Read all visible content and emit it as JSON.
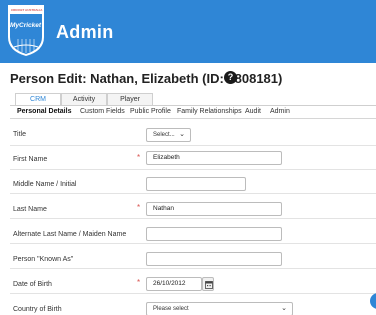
{
  "header": {
    "title": "Admin",
    "logo_text": "MyCricket",
    "logo_sub": "CRICKET AUSTRALIA"
  },
  "page": {
    "title": "Person Edit: Nathan, Elizabeth (ID: 1808181)",
    "help_icon": "question-circle-icon"
  },
  "top_tabs": [
    "CRM",
    "Activity",
    "Player"
  ],
  "sub_tabs": [
    "Personal Details",
    "Custom Fields",
    "Public Profile",
    "Family Relationships",
    "Audit",
    "Admin"
  ],
  "form": {
    "title": {
      "label": "Title",
      "value": "Select..."
    },
    "first_name": {
      "label": "First Name",
      "value": "Elizabeth",
      "required": "*"
    },
    "middle_name": {
      "label": "Middle Name / Initial",
      "value": ""
    },
    "last_name": {
      "label": "Last Name",
      "value": "Nathan",
      "required": "*"
    },
    "alt_last_name": {
      "label": "Alternate Last Name / Maiden Name",
      "value": ""
    },
    "known_as": {
      "label": "Person \"Known As\"",
      "value": ""
    },
    "dob": {
      "label": "Date of Birth",
      "value": "26/10/2012",
      "required": "*"
    },
    "country": {
      "label": "Country of Birth",
      "value": "Please select"
    }
  },
  "colors": {
    "header_bg": "#2f86d6",
    "required": "#d9534f",
    "active_tab": "#2f86d6"
  }
}
